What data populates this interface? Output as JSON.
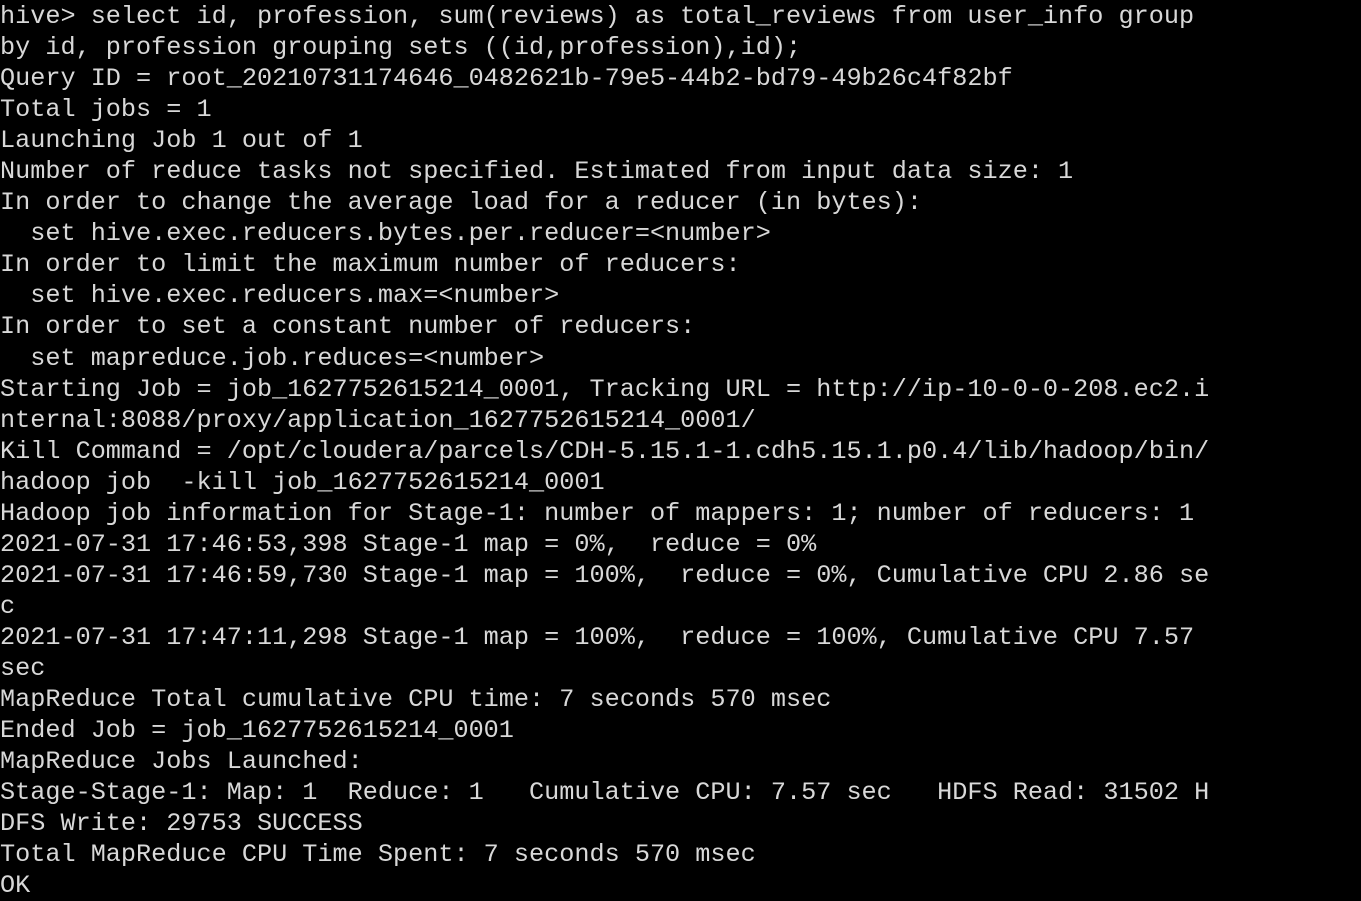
{
  "terminal": {
    "title": "hive-cli-output",
    "colors": {
      "background": "#000000",
      "foreground": "#d8d8d8"
    },
    "columns": 78,
    "prompt": "hive>",
    "query": "select id, profession, sum(reviews) as total_reviews from user_info group by id, profession grouping sets ((id,profession),id);",
    "query_id": "root_20210731174646_0482621b-79e5-44b2-bd79-49b26c4f82bf",
    "total_jobs": "1",
    "job_id": "job_1627752615214_0001",
    "application_id": "application_1627752615214_0001",
    "tracking_url": "http://ip-10-0-0-208.ec2.internal:8088/proxy/application_1627752615214_0001/",
    "kill_command_path": "/opt/cloudera/parcels/CDH-5.15.1-1.cdh5.15.1.p0.4/lib/hadoop/bin/hadoop job  -kill job_1627752615214_0001",
    "num_mappers": "1",
    "num_reducers": "1",
    "cumulative_cpu_sec": "7.57",
    "hdfs_read": "31502",
    "hdfs_write": "29753",
    "status": "SUCCESS",
    "total_cpu_time": "7 seconds 570 msec",
    "final_status": "OK",
    "lines": [
      "hive> select id, profession, sum(reviews) as total_reviews from user_info group",
      "by id, profession grouping sets ((id,profession),id);",
      "Query ID = root_20210731174646_0482621b-79e5-44b2-bd79-49b26c4f82bf",
      "Total jobs = 1",
      "Launching Job 1 out of 1",
      "Number of reduce tasks not specified. Estimated from input data size: 1",
      "In order to change the average load for a reducer (in bytes):",
      "  set hive.exec.reducers.bytes.per.reducer=<number>",
      "In order to limit the maximum number of reducers:",
      "  set hive.exec.reducers.max=<number>",
      "In order to set a constant number of reducers:",
      "  set mapreduce.job.reduces=<number>",
      "Starting Job = job_1627752615214_0001, Tracking URL = http://ip-10-0-0-208.ec2.i",
      "nternal:8088/proxy/application_1627752615214_0001/",
      "Kill Command = /opt/cloudera/parcels/CDH-5.15.1-1.cdh5.15.1.p0.4/lib/hadoop/bin/",
      "hadoop job  -kill job_1627752615214_0001",
      "Hadoop job information for Stage-1: number of mappers: 1; number of reducers: 1",
      "2021-07-31 17:46:53,398 Stage-1 map = 0%,  reduce = 0%",
      "2021-07-31 17:46:59,730 Stage-1 map = 100%,  reduce = 0%, Cumulative CPU 2.86 se",
      "c",
      "2021-07-31 17:47:11,298 Stage-1 map = 100%,  reduce = 100%, Cumulative CPU 7.57 ",
      "sec",
      "MapReduce Total cumulative CPU time: 7 seconds 570 msec",
      "Ended Job = job_1627752615214_0001",
      "MapReduce Jobs Launched:",
      "Stage-Stage-1: Map: 1  Reduce: 1   Cumulative CPU: 7.57 sec   HDFS Read: 31502 H",
      "DFS Write: 29753 SUCCESS",
      "Total MapReduce CPU Time Spent: 7 seconds 570 msec",
      "OK"
    ]
  }
}
